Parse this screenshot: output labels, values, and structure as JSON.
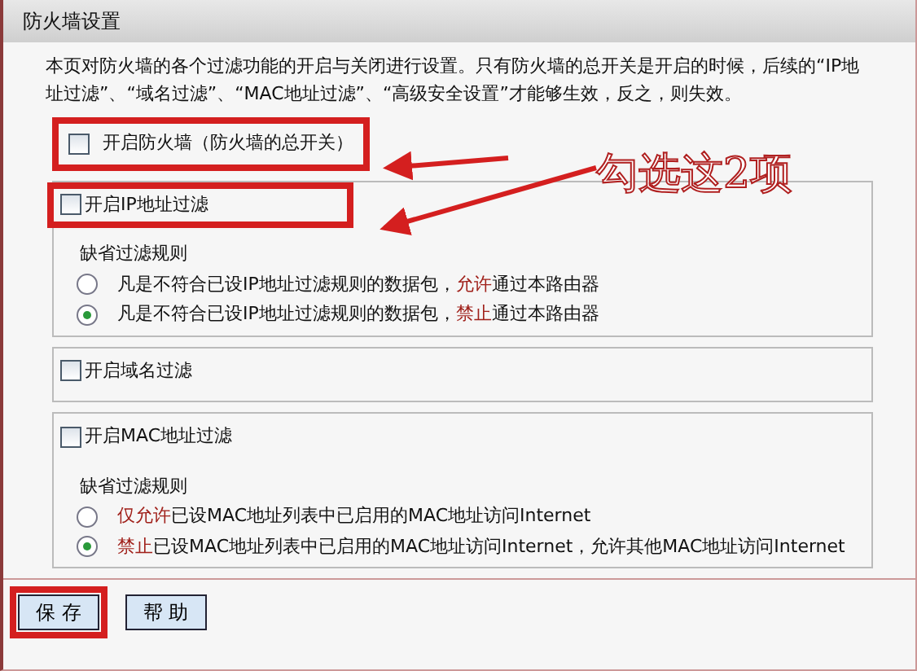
{
  "title": "防火墙设置",
  "description": "本页对防火墙的各个过滤功能的开启与关闭进行设置。只有防火墙的总开关是开启的时候，后续的“IP地址过滤”、“域名过滤”、“MAC地址过滤”、“高级安全设置”才能够生效，反之，则失效。",
  "master_switch": {
    "label": "开启防火墙（防火墙的总开关）",
    "checked": false,
    "annotated": true
  },
  "sections": [
    {
      "label": "开启IP地址过滤",
      "checked": false,
      "annotated": true,
      "rule_title": "缺省过滤规则",
      "options": [
        {
          "selected": false,
          "parts": [
            {
              "text": "凡是不符合已设IP地址过滤规则的数据包，"
            },
            {
              "text": "允许",
              "highlight": true
            },
            {
              "text": "通过本路由器"
            }
          ]
        },
        {
          "selected": true,
          "parts": [
            {
              "text": "凡是不符合已设IP地址过滤规则的数据包，"
            },
            {
              "text": "禁止",
              "highlight": true
            },
            {
              "text": "通过本路由器"
            }
          ]
        }
      ]
    },
    {
      "label": "开启域名过滤",
      "checked": false,
      "annotated": false
    },
    {
      "label": "开启MAC地址过滤",
      "checked": false,
      "annotated": false,
      "rule_title": "缺省过滤规则",
      "options": [
        {
          "selected": false,
          "parts": [
            {
              "text": "仅允许",
              "highlight": true
            },
            {
              "text": "已设MAC地址列表中已启用的MAC地址访问Internet"
            }
          ]
        },
        {
          "selected": true,
          "parts": [
            {
              "text": "禁止",
              "highlight": true
            },
            {
              "text": "已设MAC地址列表中已启用的MAC地址访问Internet，允许其他MAC地址访问Internet"
            }
          ]
        }
      ]
    }
  ],
  "buttons": [
    {
      "label": "保 存",
      "annotated": true
    },
    {
      "label": "帮 助",
      "annotated": false
    }
  ],
  "annotation": {
    "text": "勾选这2项"
  }
}
